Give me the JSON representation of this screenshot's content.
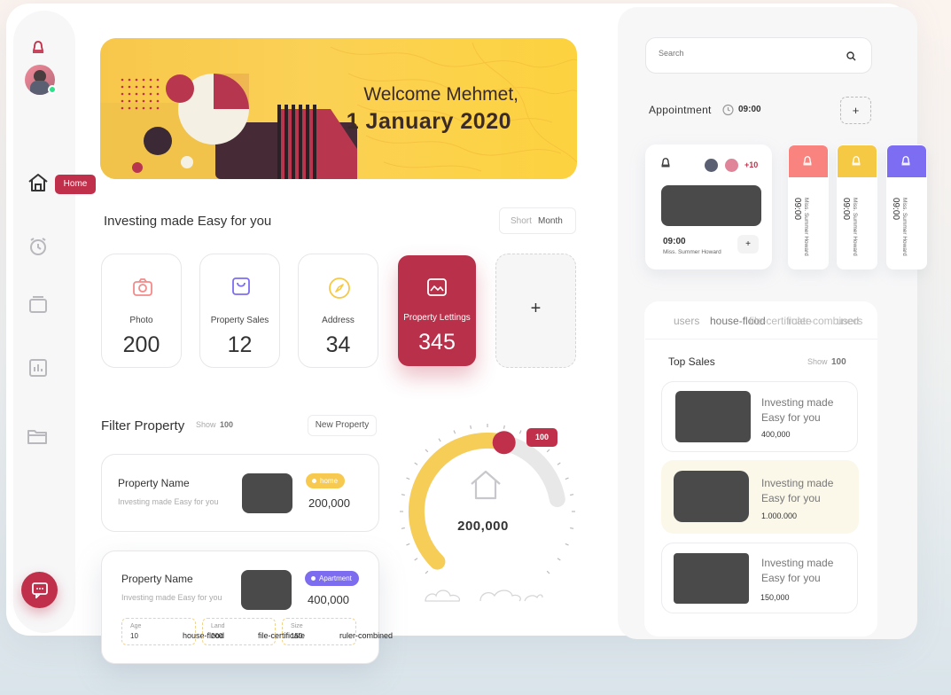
{
  "sidebar": {
    "home_tooltip": "Home"
  },
  "banner": {
    "welcome": "Welcome Mehmet,",
    "date": "1 January 2020"
  },
  "invest": {
    "title": "Investing made Easy for you",
    "toggle": [
      "Short",
      "Month"
    ]
  },
  "stats": [
    {
      "label": "Photo",
      "value": "200",
      "icon": "camera-icon"
    },
    {
      "label": "Property Sales",
      "value": "12",
      "icon": "shopping-bag-icon"
    },
    {
      "label": "Address",
      "value": "34",
      "icon": "compass-icon"
    },
    {
      "label": "Property Lettings",
      "value": "345",
      "icon": "image-icon"
    }
  ],
  "add_symbol": "+",
  "filter": {
    "title": "Filter Property",
    "show_label": "Show",
    "show_value": "100",
    "new_button": "New Property"
  },
  "properties": [
    {
      "name": "Property Name",
      "desc": "Investing made Easy for you",
      "badge": "home",
      "price": "200,000",
      "badge_color": "#f7c94e"
    },
    {
      "name": "Property Name",
      "desc": "Investing made Easy for you",
      "badge": "Apartment",
      "price": "400,000",
      "badge_color": "#7d6bf0",
      "details": [
        {
          "label": "Age",
          "value": "10",
          "icon_text": "house-flood"
        },
        {
          "label": "Land",
          "value": "200",
          "icon_text": "file-certificate"
        },
        {
          "label": "Size",
          "value": "150",
          "icon_text": "ruler-combined"
        }
      ]
    }
  ],
  "gauge": {
    "value": "200,000",
    "knob_value": "100",
    "fill_fraction": 0.55,
    "fill_color": "#f6cd57",
    "track_color": "#e8e8e8",
    "knob_color": "#c0304a"
  },
  "search": {
    "placeholder": "Search"
  },
  "appointment": {
    "title": "Appointment",
    "time": "09:00",
    "add": "+",
    "card": {
      "time": "09:00",
      "person": "Miss. Summer Howard",
      "extra": "+10",
      "add": "+"
    },
    "mini": [
      {
        "time": "09:00",
        "person": "Miss. Summer Howard",
        "color": "#f9837f"
      },
      {
        "time": "09:00",
        "person": "Miss. Summer Howard",
        "color": "#f6c945"
      },
      {
        "time": "09:00",
        "person": "Miss. Summer Howard",
        "color": "#7c6df2"
      }
    ]
  },
  "tabs": [
    "users",
    "house-flood",
    "file-certificate",
    "ruler-combined",
    "users"
  ],
  "top_sales": {
    "title": "Top Sales",
    "show_label": "Show",
    "show_value": "100",
    "items": [
      {
        "text": "Investing made Easy for you",
        "value": "400,000"
      },
      {
        "text": "Investing made Easy for you",
        "value": "1.000.000"
      },
      {
        "text": "Investing made Easy for you",
        "value": "150,000"
      }
    ]
  },
  "colors": {
    "accent": "#c0304a",
    "online": "#2ee08a",
    "yellow": "#f7c94e",
    "purple": "#7d6bf0"
  }
}
